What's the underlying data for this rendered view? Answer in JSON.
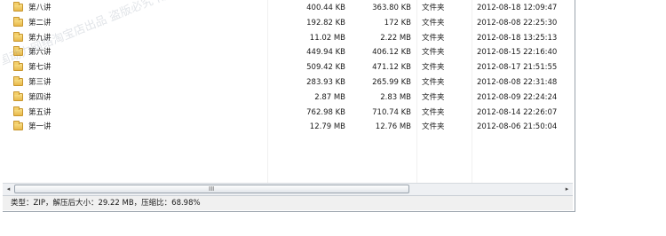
{
  "files": [
    {
      "name": "第八讲",
      "size": "400.44 KB",
      "packed": "363.80 KB",
      "type": "文件夹",
      "modified": "2012-08-18 12:09:47"
    },
    {
      "name": "第二讲",
      "size": "192.82 KB",
      "packed": "172 KB",
      "type": "文件夹",
      "modified": "2012-08-08 22:25:30"
    },
    {
      "name": "第九讲",
      "size": "11.02 MB",
      "packed": "2.22 MB",
      "type": "文件夹",
      "modified": "2012-08-18 13:25:13"
    },
    {
      "name": "第六讲",
      "size": "449.94 KB",
      "packed": "406.12 KB",
      "type": "文件夹",
      "modified": "2012-08-15 22:16:40"
    },
    {
      "name": "第七讲",
      "size": "509.42 KB",
      "packed": "471.12 KB",
      "type": "文件夹",
      "modified": "2012-08-17 21:51:55"
    },
    {
      "name": "第三讲",
      "size": "283.93 KB",
      "packed": "265.99 KB",
      "type": "文件夹",
      "modified": "2012-08-08 22:31:48"
    },
    {
      "name": "第四讲",
      "size": "2.87 MB",
      "packed": "2.83 MB",
      "type": "文件夹",
      "modified": "2012-08-09 22:24:24"
    },
    {
      "name": "第五讲",
      "size": "762.98 KB",
      "packed": "710.74 KB",
      "type": "文件夹",
      "modified": "2012-08-14 22:26:07"
    },
    {
      "name": "第一讲",
      "size": "12.79 MB",
      "packed": "12.76 MB",
      "type": "文件夹",
      "modified": "2012-08-06 21:50:04"
    }
  ],
  "scrollbar": {
    "left_arrow": "◂",
    "right_arrow": "▸",
    "grip": "III"
  },
  "status": {
    "text": "类型：ZIP，解压后大小：29.22 MB，压缩比：68.98%"
  },
  "watermark": {
    "text": "南国动力网络淘宝店出品  盗版必究  南国动力网络淘宝店出品"
  },
  "colors": {
    "folder": "#e8b94a",
    "statusbar": "#f0f0f0",
    "scrollbar": "#eef0f3"
  }
}
